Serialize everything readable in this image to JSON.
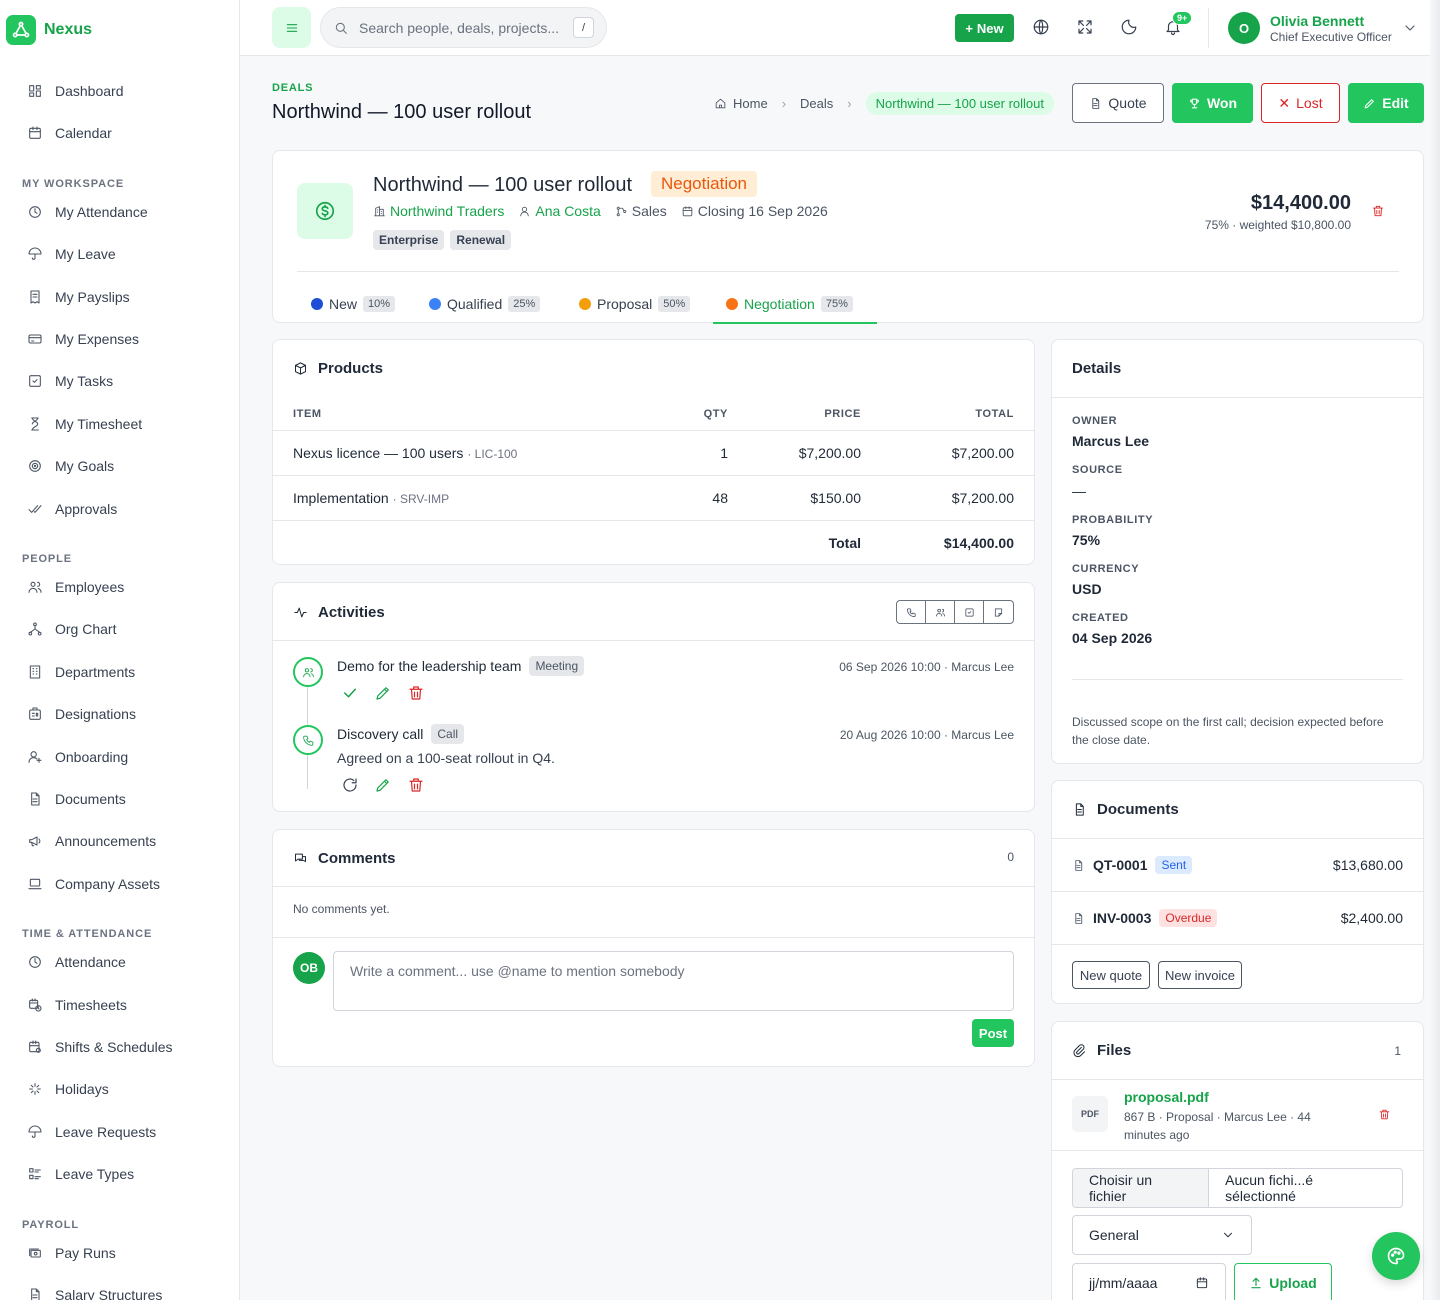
{
  "app": {
    "name": "Nexus"
  },
  "sidebar": {
    "sections": [
      {
        "label": "",
        "items": [
          {
            "label": "Dashboard",
            "icon": "dashboard-icon"
          },
          {
            "label": "Calendar",
            "icon": "calendar-icon"
          }
        ]
      },
      {
        "label": "MY WORKSPACE",
        "items": [
          {
            "label": "My Attendance",
            "icon": "clock-icon"
          },
          {
            "label": "My Leave",
            "icon": "umbrella-icon"
          },
          {
            "label": "My Payslips",
            "icon": "receipt-icon"
          },
          {
            "label": "My Expenses",
            "icon": "credit-card-icon"
          },
          {
            "label": "My Tasks",
            "icon": "checkbox-icon"
          },
          {
            "label": "My Timesheet",
            "icon": "hourglass-icon"
          },
          {
            "label": "My Goals",
            "icon": "target-icon"
          },
          {
            "label": "Approvals",
            "icon": "double-check-icon"
          }
        ]
      },
      {
        "label": "PEOPLE",
        "items": [
          {
            "label": "Employees",
            "icon": "users-icon"
          },
          {
            "label": "Org Chart",
            "icon": "org-chart-icon"
          },
          {
            "label": "Departments",
            "icon": "building-icon"
          },
          {
            "label": "Designations",
            "icon": "id-badge-icon"
          },
          {
            "label": "Onboarding",
            "icon": "user-plus-icon"
          },
          {
            "label": "Documents",
            "icon": "document-icon"
          },
          {
            "label": "Announcements",
            "icon": "megaphone-icon"
          },
          {
            "label": "Company Assets",
            "icon": "laptop-icon"
          }
        ]
      },
      {
        "label": "TIME & ATTENDANCE",
        "items": [
          {
            "label": "Attendance",
            "icon": "clock-icon"
          },
          {
            "label": "Timesheets",
            "icon": "calendar-clock-icon"
          },
          {
            "label": "Shifts & Schedules",
            "icon": "calendar-time-icon"
          },
          {
            "label": "Holidays",
            "icon": "sparkle-icon"
          },
          {
            "label": "Leave Requests",
            "icon": "umbrella-icon"
          },
          {
            "label": "Leave Types",
            "icon": "list-details-icon"
          }
        ]
      },
      {
        "label": "PAYROLL",
        "items": [
          {
            "label": "Pay Runs",
            "icon": "cash-icon"
          },
          {
            "label": "Salary Structures",
            "icon": "document-icon"
          }
        ]
      }
    ]
  },
  "topbar": {
    "search_placeholder": "Search people, deals, projects...",
    "search_shortcut": "/",
    "new_label": "New",
    "notif_badge": "9+",
    "user": {
      "initial": "O",
      "name": "Olivia Bennett",
      "role": "Chief Executive Officer"
    }
  },
  "header": {
    "eyebrow": "DEALS",
    "title": "Northwind — 100 user rollout",
    "breadcrumb": [
      "Home",
      "Deals",
      "Northwind — 100 user rollout"
    ],
    "actions": {
      "quote": "Quote",
      "won": "Won",
      "lost": "Lost",
      "edit": "Edit"
    }
  },
  "deal": {
    "name": "Northwind — 100 user rollout",
    "stage": "Negotiation",
    "company": "Northwind Traders",
    "contact": "Ana Costa",
    "pipeline": "Sales",
    "closing": "Closing 16 Sep 2026",
    "tags": [
      "Enterprise",
      "Renewal"
    ],
    "amount": "$14,400.00",
    "weighted": "75% · weighted $10,800.00",
    "stages": [
      {
        "label": "New",
        "pct": "10%",
        "color": "#1d4ed8"
      },
      {
        "label": "Qualified",
        "pct": "25%",
        "color": "#3b82f6"
      },
      {
        "label": "Proposal",
        "pct": "50%",
        "color": "#f59e0b"
      },
      {
        "label": "Negotiation",
        "pct": "75%",
        "color": "#f97316",
        "active": true
      }
    ]
  },
  "products": {
    "title": "Products",
    "columns": [
      "ITEM",
      "QTY",
      "PRICE",
      "TOTAL"
    ],
    "rows": [
      {
        "item": "Nexus licence — 100 users",
        "sku": "LIC-100",
        "qty": "1",
        "price": "$7,200.00",
        "total": "$7,200.00"
      },
      {
        "item": "Implementation",
        "sku": "SRV-IMP",
        "qty": "48",
        "price": "$150.00",
        "total": "$7,200.00"
      }
    ],
    "total_label": "Total",
    "total_value": "$14,400.00"
  },
  "activities": {
    "title": "Activities",
    "items": [
      {
        "title": "Demo for the leadership team",
        "type": "Meeting",
        "when": "06 Sep 2026 10:00 · Marcus Lee",
        "note": ""
      },
      {
        "title": "Discovery call",
        "type": "Call",
        "when": "20 Aug 2026 10:00 · Marcus Lee",
        "note": "Agreed on a 100-seat rollout in Q4."
      }
    ]
  },
  "comments": {
    "title": "Comments",
    "count": "0",
    "empty": "No comments yet.",
    "avatar": "OB",
    "placeholder": "Write a comment... use @name to mention somebody",
    "post": "Post"
  },
  "details": {
    "title": "Details",
    "fields": [
      {
        "label": "OWNER",
        "value": "Marcus Lee"
      },
      {
        "label": "SOURCE",
        "value": "—"
      },
      {
        "label": "PROBABILITY",
        "value": "75%"
      },
      {
        "label": "CURRENCY",
        "value": "USD"
      },
      {
        "label": "CREATED",
        "value": "04 Sep 2026"
      }
    ],
    "note": "Discussed scope on the first call; decision expected before the close date."
  },
  "documents": {
    "title": "Documents",
    "rows": [
      {
        "id": "QT-0001",
        "status": "Sent",
        "amount": "$13,680.00"
      },
      {
        "id": "INV-0003",
        "status": "Overdue",
        "amount": "$2,400.00"
      }
    ],
    "new_quote": "New quote",
    "new_invoice": "New invoice"
  },
  "files": {
    "title": "Files",
    "count": "1",
    "file": {
      "name": "proposal.pdf",
      "meta": "867 B · Proposal · Marcus Lee · 44 minutes ago",
      "icon_text": "PDF"
    },
    "choose_label": "Choisir un fichier",
    "no_file": "Aucun fichi...é sélectionné",
    "category": "General",
    "date_placeholder": "jj/mm/aaaa",
    "upload": "Upload"
  }
}
